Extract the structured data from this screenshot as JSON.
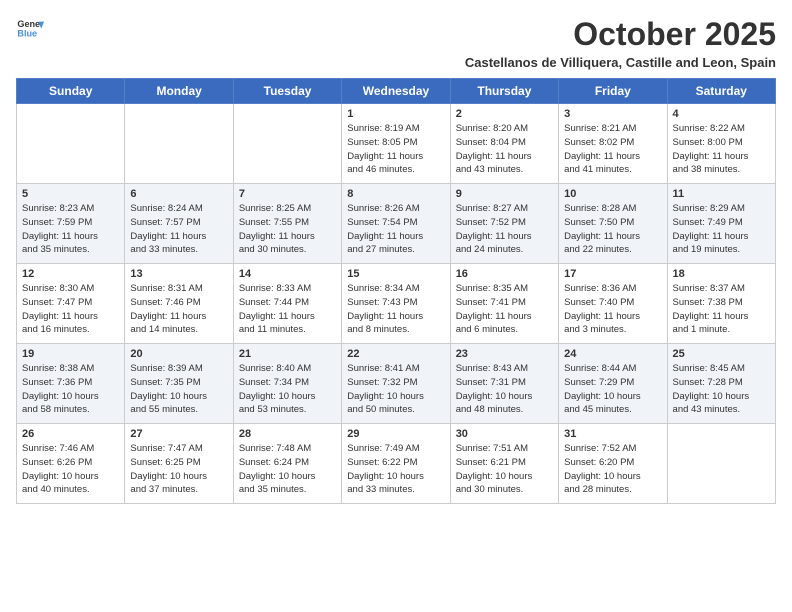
{
  "header": {
    "logo_line1": "General",
    "logo_line2": "Blue",
    "month_title": "October 2025",
    "subtitle": "Castellanos de Villiquera, Castille and Leon, Spain"
  },
  "days_of_week": [
    "Sunday",
    "Monday",
    "Tuesday",
    "Wednesday",
    "Thursday",
    "Friday",
    "Saturday"
  ],
  "weeks": [
    [
      {
        "day": "",
        "info": ""
      },
      {
        "day": "",
        "info": ""
      },
      {
        "day": "",
        "info": ""
      },
      {
        "day": "1",
        "info": "Sunrise: 8:19 AM\nSunset: 8:05 PM\nDaylight: 11 hours\nand 46 minutes."
      },
      {
        "day": "2",
        "info": "Sunrise: 8:20 AM\nSunset: 8:04 PM\nDaylight: 11 hours\nand 43 minutes."
      },
      {
        "day": "3",
        "info": "Sunrise: 8:21 AM\nSunset: 8:02 PM\nDaylight: 11 hours\nand 41 minutes."
      },
      {
        "day": "4",
        "info": "Sunrise: 8:22 AM\nSunset: 8:00 PM\nDaylight: 11 hours\nand 38 minutes."
      }
    ],
    [
      {
        "day": "5",
        "info": "Sunrise: 8:23 AM\nSunset: 7:59 PM\nDaylight: 11 hours\nand 35 minutes."
      },
      {
        "day": "6",
        "info": "Sunrise: 8:24 AM\nSunset: 7:57 PM\nDaylight: 11 hours\nand 33 minutes."
      },
      {
        "day": "7",
        "info": "Sunrise: 8:25 AM\nSunset: 7:55 PM\nDaylight: 11 hours\nand 30 minutes."
      },
      {
        "day": "8",
        "info": "Sunrise: 8:26 AM\nSunset: 7:54 PM\nDaylight: 11 hours\nand 27 minutes."
      },
      {
        "day": "9",
        "info": "Sunrise: 8:27 AM\nSunset: 7:52 PM\nDaylight: 11 hours\nand 24 minutes."
      },
      {
        "day": "10",
        "info": "Sunrise: 8:28 AM\nSunset: 7:50 PM\nDaylight: 11 hours\nand 22 minutes."
      },
      {
        "day": "11",
        "info": "Sunrise: 8:29 AM\nSunset: 7:49 PM\nDaylight: 11 hours\nand 19 minutes."
      }
    ],
    [
      {
        "day": "12",
        "info": "Sunrise: 8:30 AM\nSunset: 7:47 PM\nDaylight: 11 hours\nand 16 minutes."
      },
      {
        "day": "13",
        "info": "Sunrise: 8:31 AM\nSunset: 7:46 PM\nDaylight: 11 hours\nand 14 minutes."
      },
      {
        "day": "14",
        "info": "Sunrise: 8:33 AM\nSunset: 7:44 PM\nDaylight: 11 hours\nand 11 minutes."
      },
      {
        "day": "15",
        "info": "Sunrise: 8:34 AM\nSunset: 7:43 PM\nDaylight: 11 hours\nand 8 minutes."
      },
      {
        "day": "16",
        "info": "Sunrise: 8:35 AM\nSunset: 7:41 PM\nDaylight: 11 hours\nand 6 minutes."
      },
      {
        "day": "17",
        "info": "Sunrise: 8:36 AM\nSunset: 7:40 PM\nDaylight: 11 hours\nand 3 minutes."
      },
      {
        "day": "18",
        "info": "Sunrise: 8:37 AM\nSunset: 7:38 PM\nDaylight: 11 hours\nand 1 minute."
      }
    ],
    [
      {
        "day": "19",
        "info": "Sunrise: 8:38 AM\nSunset: 7:36 PM\nDaylight: 10 hours\nand 58 minutes."
      },
      {
        "day": "20",
        "info": "Sunrise: 8:39 AM\nSunset: 7:35 PM\nDaylight: 10 hours\nand 55 minutes."
      },
      {
        "day": "21",
        "info": "Sunrise: 8:40 AM\nSunset: 7:34 PM\nDaylight: 10 hours\nand 53 minutes."
      },
      {
        "day": "22",
        "info": "Sunrise: 8:41 AM\nSunset: 7:32 PM\nDaylight: 10 hours\nand 50 minutes."
      },
      {
        "day": "23",
        "info": "Sunrise: 8:43 AM\nSunset: 7:31 PM\nDaylight: 10 hours\nand 48 minutes."
      },
      {
        "day": "24",
        "info": "Sunrise: 8:44 AM\nSunset: 7:29 PM\nDaylight: 10 hours\nand 45 minutes."
      },
      {
        "day": "25",
        "info": "Sunrise: 8:45 AM\nSunset: 7:28 PM\nDaylight: 10 hours\nand 43 minutes."
      }
    ],
    [
      {
        "day": "26",
        "info": "Sunrise: 7:46 AM\nSunset: 6:26 PM\nDaylight: 10 hours\nand 40 minutes."
      },
      {
        "day": "27",
        "info": "Sunrise: 7:47 AM\nSunset: 6:25 PM\nDaylight: 10 hours\nand 37 minutes."
      },
      {
        "day": "28",
        "info": "Sunrise: 7:48 AM\nSunset: 6:24 PM\nDaylight: 10 hours\nand 35 minutes."
      },
      {
        "day": "29",
        "info": "Sunrise: 7:49 AM\nSunset: 6:22 PM\nDaylight: 10 hours\nand 33 minutes."
      },
      {
        "day": "30",
        "info": "Sunrise: 7:51 AM\nSunset: 6:21 PM\nDaylight: 10 hours\nand 30 minutes."
      },
      {
        "day": "31",
        "info": "Sunrise: 7:52 AM\nSunset: 6:20 PM\nDaylight: 10 hours\nand 28 minutes."
      },
      {
        "day": "",
        "info": ""
      }
    ]
  ]
}
